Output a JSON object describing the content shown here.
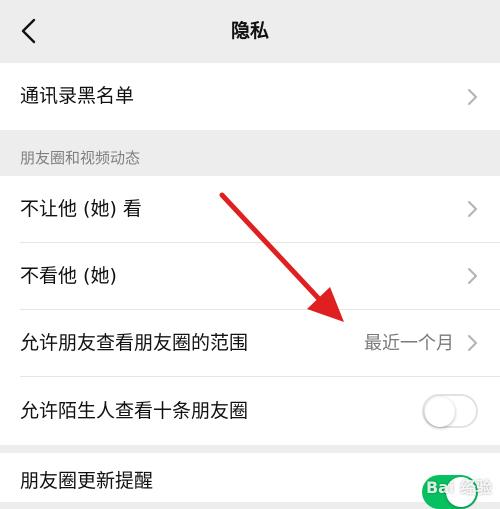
{
  "nav": {
    "title": "隐私",
    "back_icon": "chevron-left-icon"
  },
  "top_cell": {
    "label": "通讯录黑名单"
  },
  "moments_section": {
    "header": "朋友圈和视频动态",
    "items": [
      {
        "label": "不让他 (她) 看"
      },
      {
        "label": "不看他 (她)"
      },
      {
        "label": "允许朋友查看朋友圈的范围",
        "value": "最近一个月"
      },
      {
        "label": "允许陌生人查看十条朋友圈",
        "toggle": "off"
      }
    ]
  },
  "bottom_cell": {
    "label": "朋友圈更新提醒",
    "toggle": "on"
  },
  "annotation": {
    "arrow_color": "#e02020"
  },
  "watermark": {
    "text": "Bai 经验"
  },
  "colors": {
    "background": "#ededed",
    "cell": "#ffffff",
    "text": "#111111",
    "secondary_text": "#7a7a7a",
    "toggle_on": "#07c160"
  }
}
